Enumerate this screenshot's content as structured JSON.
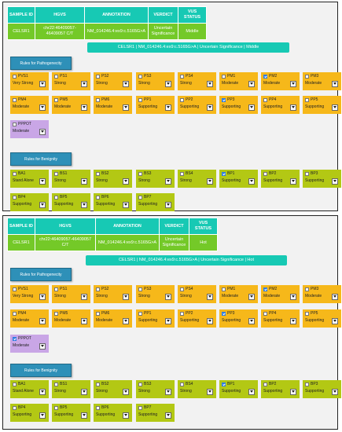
{
  "headers": [
    "SAMPLE ID",
    "HGVS",
    "ANNOTATION",
    "VERDICT",
    "VUS STATUS"
  ],
  "panels": [
    {
      "row": [
        "CELSR1",
        "chr22:46409057-46409057 C/T",
        "NM_014246.4:ex9:c.5165G>A",
        "Uncertain Significance",
        "Middle"
      ],
      "banner": "CELSR1 | NM_014246.4:ex9:c.5165G>A | Uncertain Significance | Middle",
      "pathogenic_label": "Rules for Pathogenecity",
      "benign_label": "Rules for Benignity",
      "pathogenic": [
        {
          "code": "PVS1",
          "strength": "Very Strong",
          "checked": false
        },
        {
          "code": "PS1",
          "strength": "Strong",
          "checked": false
        },
        {
          "code": "PS2",
          "strength": "Strong",
          "checked": false
        },
        {
          "code": "PS3",
          "strength": "Strong",
          "checked": false
        },
        {
          "code": "PS4",
          "strength": "Strong",
          "checked": false
        },
        {
          "code": "PM1",
          "strength": "Moderate",
          "checked": false
        },
        {
          "code": "PM2",
          "strength": "Moderate",
          "checked": true
        },
        {
          "code": "PM3",
          "strength": "Moderate",
          "checked": false
        },
        {
          "code": "PM4",
          "strength": "Moderate",
          "checked": false
        },
        {
          "code": "PM5",
          "strength": "Moderate",
          "checked": false
        },
        {
          "code": "PM6",
          "strength": "Moderate",
          "checked": false
        },
        {
          "code": "PP1",
          "strength": "Supporting",
          "checked": false
        },
        {
          "code": "PP2",
          "strength": "Supporting",
          "checked": false
        },
        {
          "code": "PP3",
          "strength": "Supporting",
          "checked": true
        },
        {
          "code": "PP4",
          "strength": "Supporting",
          "checked": false
        },
        {
          "code": "PP5",
          "strength": "Supporting",
          "checked": false
        },
        {
          "code": "PPPOT",
          "strength": "Moderate",
          "checked": false
        }
      ],
      "benign": [
        {
          "code": "BA1",
          "strength": "Stand Alone",
          "checked": false
        },
        {
          "code": "BS1",
          "strength": "Strong",
          "checked": false
        },
        {
          "code": "BS2",
          "strength": "Strong",
          "checked": false
        },
        {
          "code": "BS3",
          "strength": "Strong",
          "checked": false
        },
        {
          "code": "BS4",
          "strength": "Strong",
          "checked": false
        },
        {
          "code": "BP1",
          "strength": "Supporting",
          "checked": true
        },
        {
          "code": "BP2",
          "strength": "Supporting",
          "checked": false
        },
        {
          "code": "BP3",
          "strength": "Supporting",
          "checked": false
        },
        {
          "code": "BP4",
          "strength": "Supporting",
          "checked": false
        },
        {
          "code": "BP5",
          "strength": "Supporting",
          "checked": false
        },
        {
          "code": "BP6",
          "strength": "Supporting",
          "checked": false
        },
        {
          "code": "BP7",
          "strength": "Supporting",
          "checked": false
        }
      ]
    },
    {
      "row": [
        "CELSR1",
        "chr22:46409057-46409057 C/T",
        "NM_014246.4:ex9:c.5165G>A",
        "Uncertain Significance",
        "Hot"
      ],
      "banner": "CELSR1 | NM_014246.4:ex9:c.5165G>A | Uncertain Significance | Hot",
      "pathogenic_label": "Rules for Pathogenecity",
      "benign_label": "Rules for Benignity",
      "pathogenic": [
        {
          "code": "PVS1",
          "strength": "Very Strong",
          "checked": false
        },
        {
          "code": "PS1",
          "strength": "Strong",
          "checked": false
        },
        {
          "code": "PS2",
          "strength": "Strong",
          "checked": false
        },
        {
          "code": "PS3",
          "strength": "Strong",
          "checked": false
        },
        {
          "code": "PS4",
          "strength": "Strong",
          "checked": false
        },
        {
          "code": "PM1",
          "strength": "Moderate",
          "checked": false
        },
        {
          "code": "PM2",
          "strength": "Moderate",
          "checked": true
        },
        {
          "code": "PM3",
          "strength": "Moderate",
          "checked": false
        },
        {
          "code": "PM4",
          "strength": "Moderate",
          "checked": false
        },
        {
          "code": "PM5",
          "strength": "Moderate",
          "checked": false
        },
        {
          "code": "PM6",
          "strength": "Moderate",
          "checked": false
        },
        {
          "code": "PP1",
          "strength": "Supporting",
          "checked": false
        },
        {
          "code": "PP2",
          "strength": "Supporting",
          "checked": false
        },
        {
          "code": "PP3",
          "strength": "Supporting",
          "checked": true
        },
        {
          "code": "PP4",
          "strength": "Supporting",
          "checked": false
        },
        {
          "code": "PP5",
          "strength": "Supporting",
          "checked": false
        },
        {
          "code": "PPPOT",
          "strength": "Moderate",
          "checked": true
        }
      ],
      "benign": [
        {
          "code": "BA1",
          "strength": "Stand Alone",
          "checked": false
        },
        {
          "code": "BS1",
          "strength": "Strong",
          "checked": false
        },
        {
          "code": "BS2",
          "strength": "Strong",
          "checked": false
        },
        {
          "code": "BS3",
          "strength": "Strong",
          "checked": false
        },
        {
          "code": "BS4",
          "strength": "Strong",
          "checked": false
        },
        {
          "code": "BP1",
          "strength": "Supporting",
          "checked": true
        },
        {
          "code": "BP2",
          "strength": "Supporting",
          "checked": false
        },
        {
          "code": "BP3",
          "strength": "Supporting",
          "checked": false
        },
        {
          "code": "BP4",
          "strength": "Supporting",
          "checked": false
        },
        {
          "code": "BP5",
          "strength": "Supporting",
          "checked": false
        },
        {
          "code": "BP6",
          "strength": "Supporting",
          "checked": false
        },
        {
          "code": "BP7",
          "strength": "Supporting",
          "checked": false
        }
      ]
    }
  ]
}
